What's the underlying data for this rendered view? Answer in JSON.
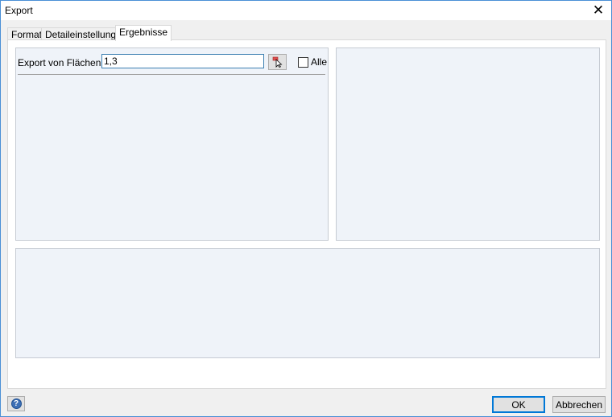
{
  "window": {
    "title": "Export",
    "close_glyph": "✕"
  },
  "tabs": [
    {
      "label": "Format"
    },
    {
      "label": "Detaileinstellungen"
    },
    {
      "label": "Ergebnisse",
      "active": true
    }
  ],
  "results": {
    "export_label": "Export von Flächen Nr.:",
    "export_value": "1,3",
    "all_label": "Alle",
    "all_checked": false,
    "pick_icon": "pointer-pick-icon"
  },
  "footer": {
    "help_glyph": "?",
    "ok_label": "OK",
    "cancel_label": "Abbrechen"
  }
}
